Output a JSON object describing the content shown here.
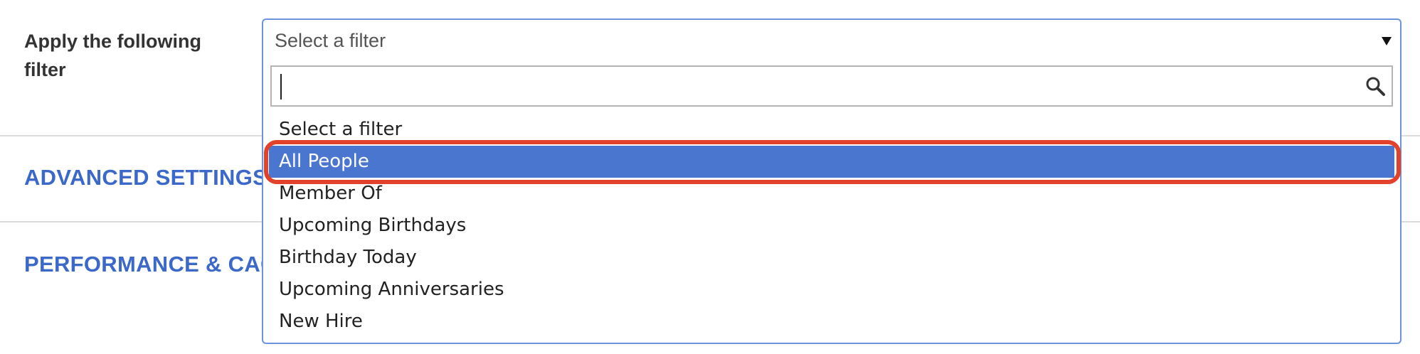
{
  "filter_field": {
    "label": "Apply the following filter",
    "selected_value": "Select a filter"
  },
  "sections": [
    {
      "title": "ADVANCED SETTINGS"
    },
    {
      "title": "PERFORMANCE & CACHE"
    }
  ],
  "dropdown": {
    "search_value": "",
    "search_icon": "search-icon",
    "options": [
      {
        "label": "Select a filter",
        "highlighted": false
      },
      {
        "label": "All People",
        "highlighted": true
      },
      {
        "label": "Member Of",
        "highlighted": false
      },
      {
        "label": "Upcoming Birthdays",
        "highlighted": false
      },
      {
        "label": "Birthday Today",
        "highlighted": false
      },
      {
        "label": "Upcoming Anniversaries",
        "highlighted": false
      },
      {
        "label": "New Hire",
        "highlighted": false
      }
    ]
  },
  "colors": {
    "accent": "#3b68c9",
    "selected_option_bg": "#4a76d0",
    "highlight_ring": "#e2422c",
    "control_border": "#6c93dd"
  }
}
